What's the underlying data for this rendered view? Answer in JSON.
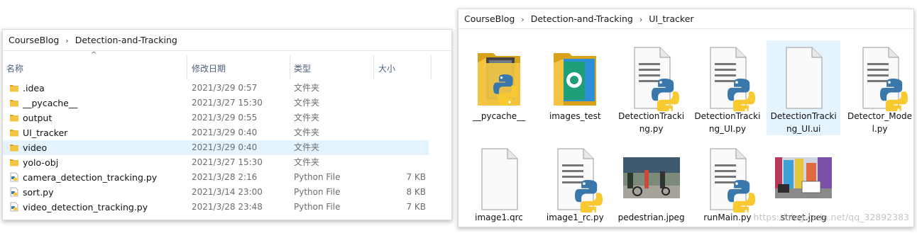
{
  "colors": {
    "folder": "#f4c542",
    "folder_dark": "#d9a21b",
    "selection": "#e5f3ff",
    "python_blue": "#3a77ab",
    "python_yellow": "#f9c932"
  },
  "left": {
    "breadcrumb": [
      "CourseBlog",
      "Detection-and-Tracking"
    ],
    "columns": {
      "name": "名称",
      "date": "修改日期",
      "type": "类型",
      "size": "大小"
    },
    "rows": [
      {
        "name": ".idea",
        "date": "2021/3/29 0:57",
        "type": "文件夹",
        "size": "",
        "icon": "folder-icon"
      },
      {
        "name": "__pycache__",
        "date": "2021/3/27 15:30",
        "type": "文件夹",
        "size": "",
        "icon": "folder-icon"
      },
      {
        "name": "output",
        "date": "2021/3/29 0:55",
        "type": "文件夹",
        "size": "",
        "icon": "folder-icon"
      },
      {
        "name": "UI_tracker",
        "date": "2021/3/29 0:40",
        "type": "文件夹",
        "size": "",
        "icon": "folder-icon"
      },
      {
        "name": "video",
        "date": "2021/3/29 0:40",
        "type": "文件夹",
        "size": "",
        "icon": "folder-icon",
        "selected": true
      },
      {
        "name": "yolo-obj",
        "date": "2021/3/27 15:30",
        "type": "文件夹",
        "size": "",
        "icon": "folder-icon"
      },
      {
        "name": "camera_detection_tracking.py",
        "date": "2021/3/28 2:16",
        "type": "Python File",
        "size": "7 KB",
        "icon": "python-file-icon"
      },
      {
        "name": "sort.py",
        "date": "2021/3/14 23:00",
        "type": "Python File",
        "size": "8 KB",
        "icon": "python-file-icon"
      },
      {
        "name": "video_detection_tracking.py",
        "date": "2021/3/28 23:48",
        "type": "Python File",
        "size": "7 KB",
        "icon": "python-file-icon"
      }
    ]
  },
  "right": {
    "breadcrumb": [
      "CourseBlog",
      "Detection-and-Tracking",
      "UI_tracker"
    ],
    "tiles": [
      {
        "label": "__pycache__",
        "icon": "folder-python-icon"
      },
      {
        "label": "images_test",
        "icon": "folder-images-icon"
      },
      {
        "label": "DetectionTracking.py",
        "icon": "python-file-icon"
      },
      {
        "label": "DetectionTracking_UI.py",
        "icon": "python-file-icon"
      },
      {
        "label": "DetectionTracking_UI.ui",
        "icon": "blank-file-icon",
        "selected": true
      },
      {
        "label": "Detector_Model.py",
        "icon": "python-file-icon"
      },
      {
        "label": "image1.qrc",
        "icon": "blank-file-icon"
      },
      {
        "label": "image1_rc.py",
        "icon": "python-file-icon"
      },
      {
        "label": "pedestrian.jpeg",
        "icon": "photo-pedestrian-icon"
      },
      {
        "label": "runMain.py",
        "icon": "python-file-icon"
      },
      {
        "label": "street.jpeg",
        "icon": "photo-street-icon"
      }
    ]
  },
  "watermark": "https://blog.csdn.net/qq_32892383"
}
